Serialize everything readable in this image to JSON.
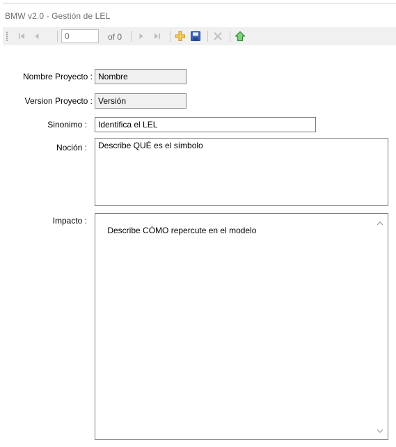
{
  "window": {
    "title": "BMW v2.0 - Gestión de LEL"
  },
  "navigator": {
    "position_value": "0",
    "count_label": "of 0",
    "icons": [
      "move-first-icon",
      "move-previous-icon",
      "move-next-icon",
      "move-last-icon",
      "add-new-icon",
      "save-icon",
      "delete-icon",
      "home-icon"
    ]
  },
  "form": {
    "nombre_proyecto": {
      "label": "Nombre Proyecto :",
      "value": "Nombre"
    },
    "version_proyecto": {
      "label": "Version Proyecto :",
      "value": "Versión"
    },
    "sinonimo": {
      "label": "Sinonimo :",
      "value": "Identifica el LEL"
    },
    "nocion": {
      "label": "Noción :",
      "value": "Describe QUÉ es el símbolo"
    },
    "impacto": {
      "label": "Impacto :",
      "value": "Describe CÓMO repercute en el modelo"
    }
  },
  "colors": {
    "add_icon": "#e8b93a",
    "save_icon": "#3a63b8",
    "home_icon": "#2fa44a",
    "delete_icon": "#c0c0c0"
  }
}
